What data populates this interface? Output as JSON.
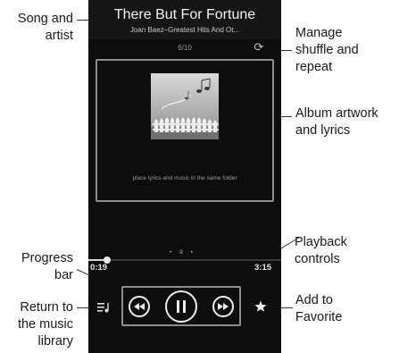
{
  "callouts": {
    "song_and_artist": [
      "Song and",
      "artist"
    ],
    "manage_shuffle": [
      "Manage",
      "shuffle and",
      "repeat"
    ],
    "album_artwork": [
      "Album artwork",
      "and lyrics"
    ],
    "progress_bar": [
      "Progress",
      "bar"
    ],
    "playback_controls": [
      "Playback",
      "controls"
    ],
    "return_library": [
      "Return to",
      "the music",
      "library"
    ],
    "add_favorite": [
      "Add to",
      "Favorite"
    ]
  },
  "player": {
    "title": "There But For Fortune",
    "artist_album": "Joan Baez–Greatest Hits And Ot...",
    "track_position": "6/10",
    "lyrics_hint": "place lyrics and music in the same folder",
    "elapsed": "0:19",
    "duration": "3:15",
    "progress_fraction": 0.097,
    "page_indicator": [
      "•",
      "②",
      "•"
    ]
  },
  "icons": {
    "shuffle_repeat": "repeat-icon",
    "library": "playlist-icon",
    "rewind": "rewind-icon",
    "pause": "pause-icon",
    "fast_forward": "fast-forward-icon",
    "favorite": "star-icon"
  },
  "colors": {
    "screen_bg": "#0d0d0d",
    "header_bg": "#161616",
    "highlight_border": "#8e8e8e",
    "text_primary": "#f2f2f2"
  }
}
